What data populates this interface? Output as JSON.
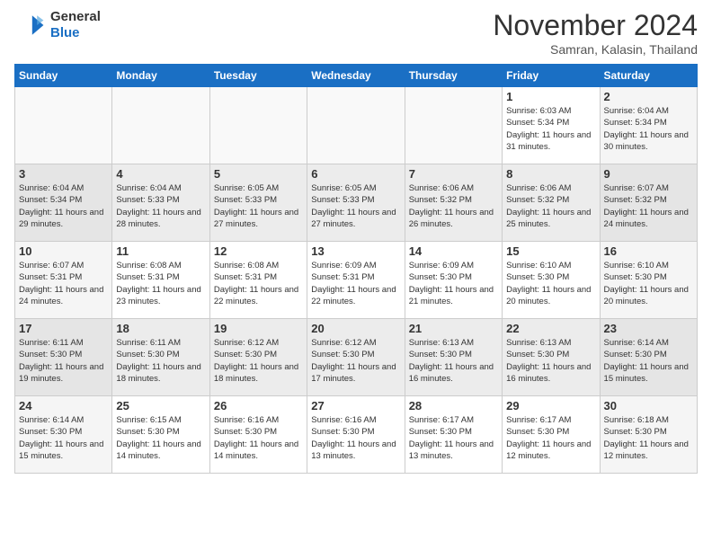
{
  "header": {
    "logo": {
      "general": "General",
      "blue": "Blue"
    },
    "title": "November 2024",
    "subtitle": "Samran, Kalasin, Thailand"
  },
  "weekdays": [
    "Sunday",
    "Monday",
    "Tuesday",
    "Wednesday",
    "Thursday",
    "Friday",
    "Saturday"
  ],
  "weeks": [
    [
      {
        "day": "",
        "info": ""
      },
      {
        "day": "",
        "info": ""
      },
      {
        "day": "",
        "info": ""
      },
      {
        "day": "",
        "info": ""
      },
      {
        "day": "",
        "info": ""
      },
      {
        "day": "1",
        "info": "Sunrise: 6:03 AM\nSunset: 5:34 PM\nDaylight: 11 hours\nand 31 minutes."
      },
      {
        "day": "2",
        "info": "Sunrise: 6:04 AM\nSunset: 5:34 PM\nDaylight: 11 hours\nand 30 minutes."
      }
    ],
    [
      {
        "day": "3",
        "info": "Sunrise: 6:04 AM\nSunset: 5:34 PM\nDaylight: 11 hours\nand 29 minutes."
      },
      {
        "day": "4",
        "info": "Sunrise: 6:04 AM\nSunset: 5:33 PM\nDaylight: 11 hours\nand 28 minutes."
      },
      {
        "day": "5",
        "info": "Sunrise: 6:05 AM\nSunset: 5:33 PM\nDaylight: 11 hours\nand 27 minutes."
      },
      {
        "day": "6",
        "info": "Sunrise: 6:05 AM\nSunset: 5:33 PM\nDaylight: 11 hours\nand 27 minutes."
      },
      {
        "day": "7",
        "info": "Sunrise: 6:06 AM\nSunset: 5:32 PM\nDaylight: 11 hours\nand 26 minutes."
      },
      {
        "day": "8",
        "info": "Sunrise: 6:06 AM\nSunset: 5:32 PM\nDaylight: 11 hours\nand 25 minutes."
      },
      {
        "day": "9",
        "info": "Sunrise: 6:07 AM\nSunset: 5:32 PM\nDaylight: 11 hours\nand 24 minutes."
      }
    ],
    [
      {
        "day": "10",
        "info": "Sunrise: 6:07 AM\nSunset: 5:31 PM\nDaylight: 11 hours\nand 24 minutes."
      },
      {
        "day": "11",
        "info": "Sunrise: 6:08 AM\nSunset: 5:31 PM\nDaylight: 11 hours\nand 23 minutes."
      },
      {
        "day": "12",
        "info": "Sunrise: 6:08 AM\nSunset: 5:31 PM\nDaylight: 11 hours\nand 22 minutes."
      },
      {
        "day": "13",
        "info": "Sunrise: 6:09 AM\nSunset: 5:31 PM\nDaylight: 11 hours\nand 22 minutes."
      },
      {
        "day": "14",
        "info": "Sunrise: 6:09 AM\nSunset: 5:30 PM\nDaylight: 11 hours\nand 21 minutes."
      },
      {
        "day": "15",
        "info": "Sunrise: 6:10 AM\nSunset: 5:30 PM\nDaylight: 11 hours\nand 20 minutes."
      },
      {
        "day": "16",
        "info": "Sunrise: 6:10 AM\nSunset: 5:30 PM\nDaylight: 11 hours\nand 20 minutes."
      }
    ],
    [
      {
        "day": "17",
        "info": "Sunrise: 6:11 AM\nSunset: 5:30 PM\nDaylight: 11 hours\nand 19 minutes."
      },
      {
        "day": "18",
        "info": "Sunrise: 6:11 AM\nSunset: 5:30 PM\nDaylight: 11 hours\nand 18 minutes."
      },
      {
        "day": "19",
        "info": "Sunrise: 6:12 AM\nSunset: 5:30 PM\nDaylight: 11 hours\nand 18 minutes."
      },
      {
        "day": "20",
        "info": "Sunrise: 6:12 AM\nSunset: 5:30 PM\nDaylight: 11 hours\nand 17 minutes."
      },
      {
        "day": "21",
        "info": "Sunrise: 6:13 AM\nSunset: 5:30 PM\nDaylight: 11 hours\nand 16 minutes."
      },
      {
        "day": "22",
        "info": "Sunrise: 6:13 AM\nSunset: 5:30 PM\nDaylight: 11 hours\nand 16 minutes."
      },
      {
        "day": "23",
        "info": "Sunrise: 6:14 AM\nSunset: 5:30 PM\nDaylight: 11 hours\nand 15 minutes."
      }
    ],
    [
      {
        "day": "24",
        "info": "Sunrise: 6:14 AM\nSunset: 5:30 PM\nDaylight: 11 hours\nand 15 minutes."
      },
      {
        "day": "25",
        "info": "Sunrise: 6:15 AM\nSunset: 5:30 PM\nDaylight: 11 hours\nand 14 minutes."
      },
      {
        "day": "26",
        "info": "Sunrise: 6:16 AM\nSunset: 5:30 PM\nDaylight: 11 hours\nand 14 minutes."
      },
      {
        "day": "27",
        "info": "Sunrise: 6:16 AM\nSunset: 5:30 PM\nDaylight: 11 hours\nand 13 minutes."
      },
      {
        "day": "28",
        "info": "Sunrise: 6:17 AM\nSunset: 5:30 PM\nDaylight: 11 hours\nand 13 minutes."
      },
      {
        "day": "29",
        "info": "Sunrise: 6:17 AM\nSunset: 5:30 PM\nDaylight: 11 hours\nand 12 minutes."
      },
      {
        "day": "30",
        "info": "Sunrise: 6:18 AM\nSunset: 5:30 PM\nDaylight: 11 hours\nand 12 minutes."
      }
    ]
  ]
}
